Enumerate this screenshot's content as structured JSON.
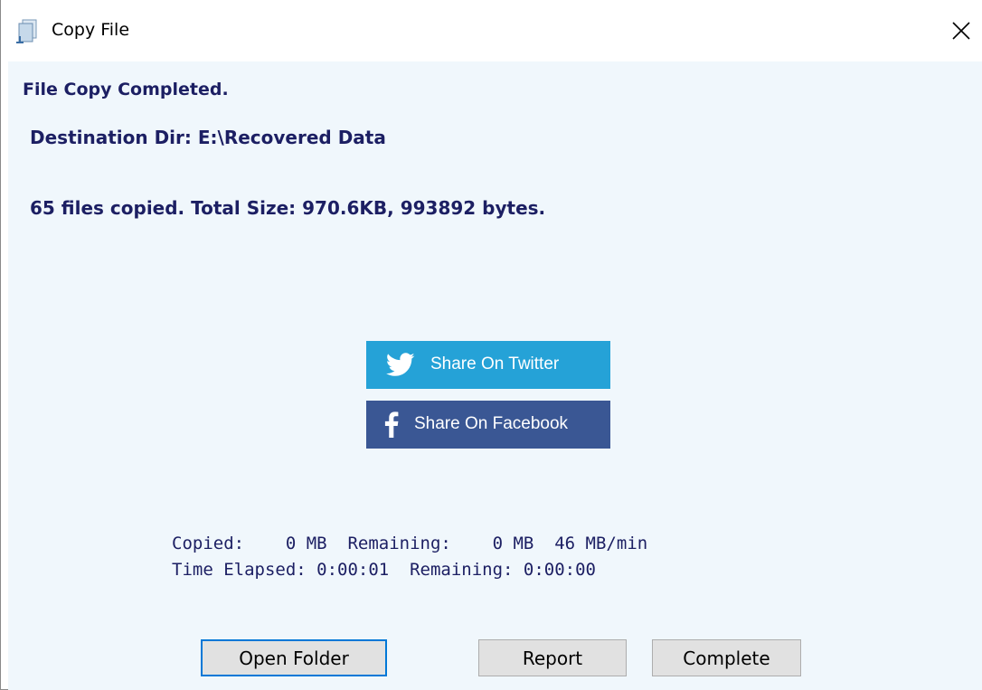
{
  "window": {
    "title": "Copy File",
    "app_icon": "copy-file-icon",
    "close_icon": "close-icon"
  },
  "messages": {
    "completed": "File Copy Completed.",
    "destination": "Destination Dir: E:\\Recovered Data",
    "summary": "65 files copied. Total Size: 970.6KB, 993892 bytes."
  },
  "share": {
    "twitter_label": "Share On Twitter",
    "twitter_icon": "twitter-bird-icon",
    "twitter_color": "#25a2d7",
    "facebook_label": "Share On Facebook",
    "facebook_icon": "facebook-f-icon",
    "facebook_color": "#3a5794"
  },
  "stats": {
    "line1": "Copied:    0 MB  Remaining:    0 MB  46 MB/min",
    "line2": "Time Elapsed: 0:00:01  Remaining: 0:00:00"
  },
  "buttons": {
    "open_folder": "Open Folder",
    "report": "Report",
    "complete": "Complete"
  },
  "colors": {
    "text_accent": "#1c1f63",
    "client_bg": "#f0f7fc",
    "focus_border": "#0078d7"
  }
}
